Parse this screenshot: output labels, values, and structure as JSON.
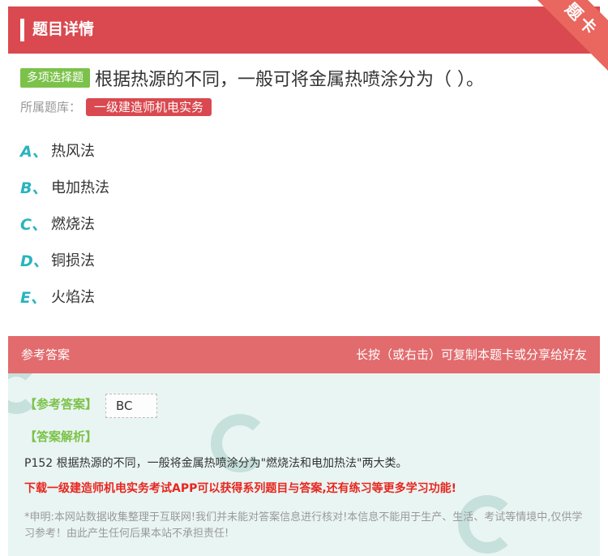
{
  "header": {
    "title": "题目详情",
    "ribbon": "题卡"
  },
  "question": {
    "type": "多项选择题",
    "text": "根据热源的不同，一般可将金属热喷涂分为（   ）。",
    "bank_label": "所属题库：",
    "bank_name": "一级建造师机电实务"
  },
  "options": [
    {
      "letter": "A、",
      "text": "热风法"
    },
    {
      "letter": "B、",
      "text": "电加热法"
    },
    {
      "letter": "C、",
      "text": "燃烧法"
    },
    {
      "letter": "D、",
      "text": "铜损法"
    },
    {
      "letter": "E、",
      "text": "火焰法"
    }
  ],
  "answer": {
    "head_left": "参考答案",
    "head_right": "长按（或右击）可复制本题卡或分享给好友",
    "ans_label": "【参考答案】",
    "ans_value": "BC",
    "exp_label": "【答案解析】",
    "exp_text": "P152 根据热源的不同，一般将金属热喷涂分为\"燃烧法和电加热法\"两大类。",
    "promo": "下载一级建造师机电实务考试APP可以获得系列题目与答案,还有练习等更多学习功能!",
    "disclaimer": "*申明:本网站数据收集整理于互联网!我们并未能对答案信息进行核对!本信息不能用于生产、生活、考试等情境中,仅供学习参考！由此产生任何后果本站不承担责任!"
  },
  "colors": {
    "header": "#d9494f",
    "ribbon": "#e9675e",
    "type_badge": "#7cc24a",
    "option_letter": "#28b4bd",
    "answer_head": "#e26b6d",
    "answer_body": "#e9f5f3",
    "promo": "#e8261f"
  }
}
